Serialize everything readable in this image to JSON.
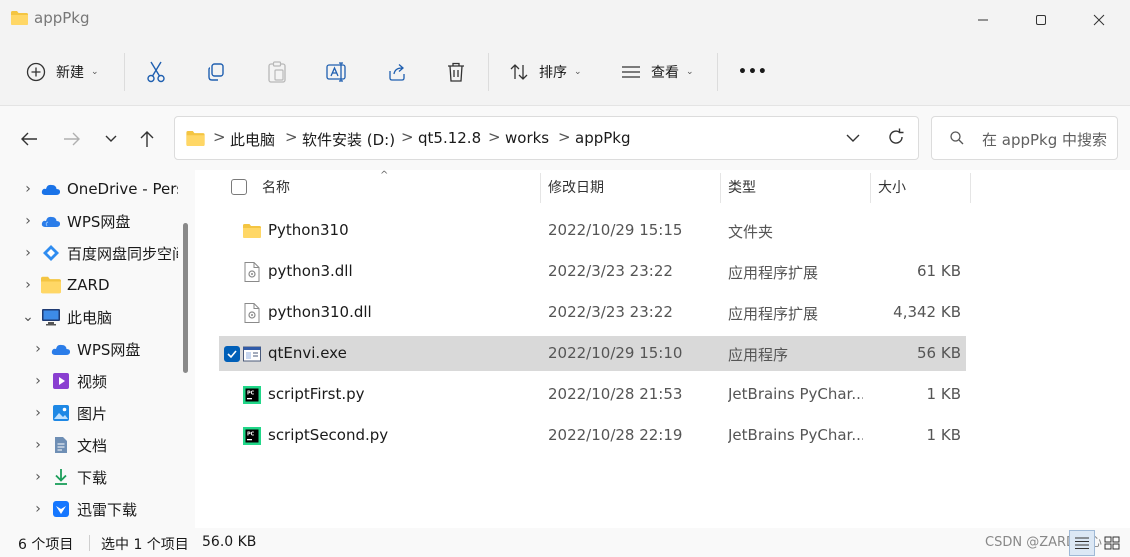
{
  "window": {
    "title": "appPkg"
  },
  "toolbar": {
    "new_label": "新建",
    "sort_label": "排序",
    "view_label": "查看",
    "more_label": "•••"
  },
  "address": {
    "crumbs": [
      "此电脑",
      "软件安装 (D:)",
      "qt5.12.8",
      "works",
      "appPkg"
    ],
    "separator": ">"
  },
  "search": {
    "placeholder": "在 appPkg 中搜索"
  },
  "sidebar": {
    "items": [
      {
        "label": "OneDrive - Pers",
        "icon": "onedrive-cloud-icon"
      },
      {
        "label": "WPS网盘",
        "icon": "wps-cloud-icon"
      },
      {
        "label": "百度网盘同步空间",
        "icon": "baidu-sync-icon"
      },
      {
        "label": "ZARD",
        "icon": "folder-icon"
      },
      {
        "label": "此电脑",
        "icon": "computer-icon"
      },
      {
        "label": "WPS网盘",
        "icon": "wps-cloud-icon"
      },
      {
        "label": "视频",
        "icon": "video-icon"
      },
      {
        "label": "图片",
        "icon": "pictures-icon"
      },
      {
        "label": "文档",
        "icon": "documents-icon"
      },
      {
        "label": "下载",
        "icon": "download-icon"
      },
      {
        "label": "迅雷下载",
        "icon": "xunlei-icon"
      }
    ]
  },
  "columns": {
    "name": "名称",
    "date": "修改日期",
    "type": "类型",
    "size": "大小"
  },
  "files": [
    {
      "name": "Python310",
      "date": "2022/10/29 15:15",
      "type": "文件夹",
      "size": "",
      "icon": "folder-icon",
      "selected": false
    },
    {
      "name": "python3.dll",
      "date": "2022/3/23 23:22",
      "type": "应用程序扩展",
      "size": "61 KB",
      "icon": "dll-file-icon",
      "selected": false
    },
    {
      "name": "python310.dll",
      "date": "2022/3/23 23:22",
      "type": "应用程序扩展",
      "size": "4,342 KB",
      "icon": "dll-file-icon",
      "selected": false
    },
    {
      "name": "qtEnvi.exe",
      "date": "2022/10/29 15:10",
      "type": "应用程序",
      "size": "56 KB",
      "icon": "exe-file-icon",
      "selected": true
    },
    {
      "name": "scriptFirst.py",
      "date": "2022/10/28 21:53",
      "type": "JetBrains PyChar...",
      "size": "1 KB",
      "icon": "pycharm-file-icon",
      "selected": false
    },
    {
      "name": "scriptSecond.py",
      "date": "2022/10/28 22:19",
      "type": "JetBrains PyChar...",
      "size": "1 KB",
      "icon": "pycharm-file-icon",
      "selected": false
    }
  ],
  "status": {
    "item_count": "6 个项目",
    "selected": "选中 1 个项目",
    "selected_size": "56.0 KB",
    "watermark": "CSDN @ZARD帧心"
  }
}
